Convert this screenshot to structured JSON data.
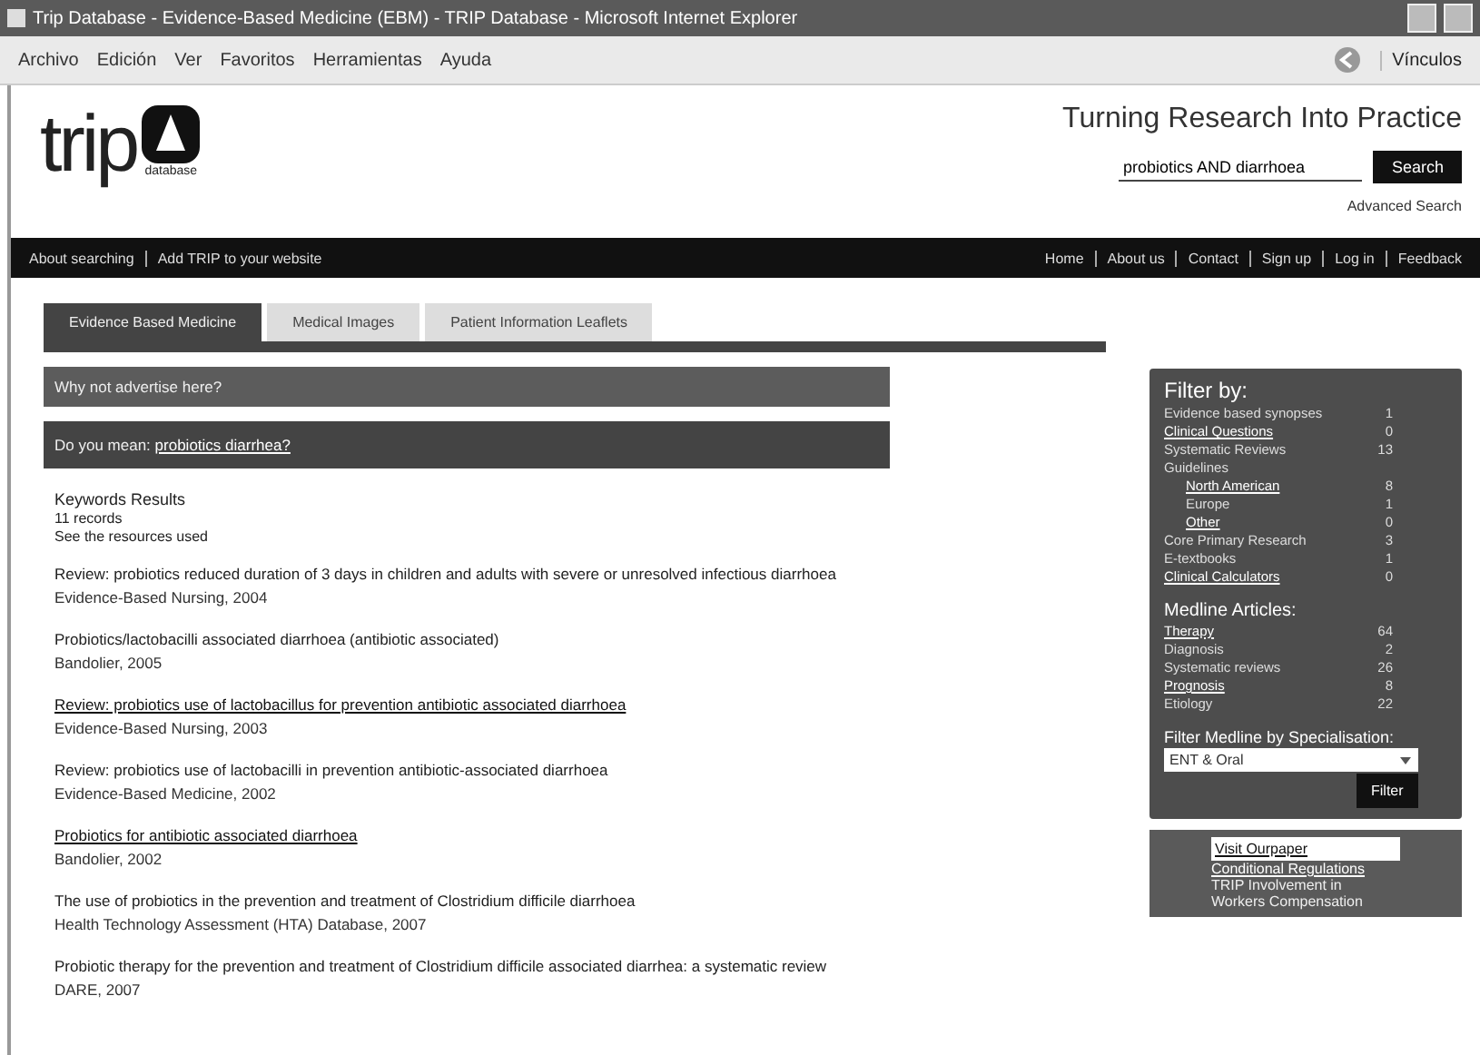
{
  "window": {
    "title": "Trip Database - Evidence-Based Medicine (EBM) - TRIP Database - Microsoft Internet Explorer"
  },
  "menu": [
    "Archivo",
    "Edición",
    "Ver",
    "Favoritos",
    "Herramientas",
    "Ayuda"
  ],
  "toolbar": {
    "links_label": "Vínculos"
  },
  "header": {
    "logo": "trip",
    "logo_sub": "database",
    "tagline": "Turning Research Into Practice",
    "search": {
      "value": "probiotics AND diarrhoea"
    },
    "search_button": "Search",
    "advanced": "Advanced Search"
  },
  "navbar": {
    "left": [
      "About searching",
      "Add TRIP to your website"
    ],
    "right": [
      "Home",
      "About us",
      "Contact",
      "Sign up",
      "Log in",
      "Feedback"
    ]
  },
  "tabs": [
    {
      "label": "Evidence Based Medicine",
      "selected": true
    },
    {
      "label": "Medical Images",
      "selected": false
    },
    {
      "label": "Patient Information Leaflets",
      "selected": false
    }
  ],
  "banners": [
    {
      "text": "Why not advertise here?"
    },
    {
      "text": "Do you mean:",
      "link": "probiotics diarrhea?"
    }
  ],
  "summary": {
    "title": "Keywords Results",
    "count": "11 records",
    "resources": "See the resources used"
  },
  "results": [
    {
      "title": "Review: probiotics reduced duration of 3 days in children and adults with severe or unresolved infectious diarrhoea",
      "source": "Evidence-Based Nursing, 2004",
      "link": false
    },
    {
      "title": "Probiotics/lactobacilli associated diarrhoea (antibiotic associated)",
      "source": "Bandolier, 2005",
      "link": false
    },
    {
      "title": "Review: probiotics use of lactobacillus for prevention antibiotic associated diarrhoea",
      "source": "Evidence-Based Nursing, 2003",
      "link": true
    },
    {
      "title": "Review: probiotics use of lactobacilli in prevention antibiotic-associated diarrhoea",
      "source": "Evidence-Based Medicine, 2002",
      "link": false
    },
    {
      "title": "Probiotics for antibiotic associated diarrhoea",
      "source": "Bandolier, 2002",
      "link": true
    },
    {
      "title": "The use of probiotics in the prevention and treatment of Clostridium difficile diarrhoea",
      "source": "Health Technology Assessment (HTA) Database, 2007",
      "link": false
    },
    {
      "title": "Probiotic therapy for the prevention and treatment of Clostridium difficile associated diarrhea: a systematic review",
      "source": "DARE, 2007",
      "link": false
    }
  ],
  "filter": {
    "title": "Filter by:",
    "items": [
      {
        "label": "Evidence based synopses",
        "count": "1",
        "link": false
      },
      {
        "label": "Clinical Questions",
        "count": "0",
        "link": true
      },
      {
        "label": "Systematic Reviews",
        "count": "13",
        "link": false
      },
      {
        "label": "Guidelines",
        "link": false,
        "children": [
          {
            "label": "North American",
            "count": "8",
            "link": true
          },
          {
            "label": "Europe",
            "count": "1",
            "link": false
          },
          {
            "label": "Other",
            "count": "0",
            "link": true
          }
        ]
      },
      {
        "label": "Core Primary Research",
        "count": "3",
        "link": false
      },
      {
        "label": "E-textbooks",
        "count": "1",
        "link": false
      },
      {
        "label": "Clinical Calculators",
        "count": "0",
        "link": true
      }
    ],
    "medline_title": "Medline Articles:",
    "medline": [
      {
        "label": "Therapy",
        "count": "64",
        "link": true
      },
      {
        "label": "Diagnosis",
        "count": "2",
        "link": false
      },
      {
        "label": "Systematic reviews",
        "count": "26",
        "link": false
      },
      {
        "label": "Prognosis",
        "count": "8",
        "link": true
      },
      {
        "label": "Etiology",
        "count": "22",
        "link": false
      }
    ],
    "spec_title": "Filter Medline by Specialisation:",
    "spec_value": "ENT & Oral",
    "button": "Filter"
  },
  "promo": {
    "heading": "Visit Ourpaper",
    "link": "Conditional Regulations",
    "lines": [
      "TRIP Involvement in",
      "Workers Compensation"
    ]
  }
}
